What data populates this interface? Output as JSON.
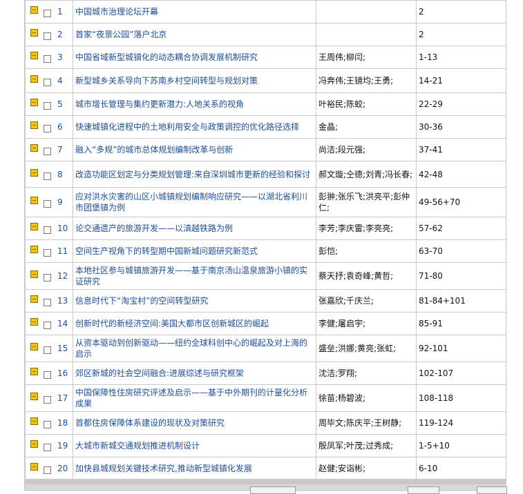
{
  "rows": [
    {
      "num": "1",
      "title": "中国城市治理论坛开幕",
      "authors": "",
      "pages": "2"
    },
    {
      "num": "2",
      "title": "首家“夜景公园”落户北京",
      "authors": "",
      "pages": "2"
    },
    {
      "num": "3",
      "title": "中国省域新型城镇化的动态耦合协调发展机制研究",
      "authors": "王周伟;柳闫;",
      "pages": "1-13"
    },
    {
      "num": "4",
      "title": "新型城乡关系导向下苏南乡村空间转型与规划对策",
      "authors": "冯奔伟;王镜均;王勇;",
      "pages": "14-21"
    },
    {
      "num": "5",
      "title": "城市增长管理与集约更新潜力:人地关系的视角",
      "authors": "叶裕民;陈蛟;",
      "pages": "22-29"
    },
    {
      "num": "6",
      "title": "快速城镇化进程中的土地利用安全与政策调控的优化路径选择",
      "authors": "金晶;",
      "pages": "30-36"
    },
    {
      "num": "7",
      "title": "融入“多规”的城市总体规划编制改革与创新",
      "authors": "尚洁;段元强;",
      "pages": "37-41"
    },
    {
      "num": "8",
      "title": "改造功能区划定与分类规划管理:来自深圳城市更新的经验和探讨",
      "authors": "郝文璇;仝德;刘青;冯长春;",
      "pages": "42-48"
    },
    {
      "num": "9",
      "title": "应对洪水灾害的山区小城镇规划编制响应研究——以湖北省利川市团堡镇为例",
      "authors": "彭翀;张乐飞;洪亮平;彭仲仁;",
      "pages": "49-56+70"
    },
    {
      "num": "10",
      "title": "论交通遗产的旅游开发——以滇越铁路为例",
      "authors": "李芳;李庆雷;李亮亮;",
      "pages": "57-62"
    },
    {
      "num": "11",
      "title": "空间生产视角下的转型期中国新城问题研究新范式",
      "authors": "彭恺;",
      "pages": "63-70"
    },
    {
      "num": "12",
      "title": "本地社区参与城镇旅游开发——基于南京汤山温泉旅游小镇的实证研究",
      "authors": "蔡天抒;袁奇峰;黄哲;",
      "pages": "71-80"
    },
    {
      "num": "13",
      "title": "信息时代下“淘宝村”的空间转型研究",
      "authors": "张嘉欣;千庆兰;",
      "pages": "81-84+101"
    },
    {
      "num": "14",
      "title": "创新时代的新经济空间:美国大都市区创新城区的崛起",
      "authors": "李健;屠启宇;",
      "pages": "85-91"
    },
    {
      "num": "15",
      "title": "从资本驱动到创新驱动——纽约全球科创中心的崛起及对上海的启示",
      "authors": "盛垒;洪娜;黄亮;张虹;",
      "pages": "92-101"
    },
    {
      "num": "16",
      "title": "郊区新城的社会空间融合:进展综述与研究框架",
      "authors": "沈洁;罗翔;",
      "pages": "102-107"
    },
    {
      "num": "17",
      "title": "中国保障性住房研究评述及启示——基于中外期刊的计量化分析成果",
      "authors": "徐苗;杨碧波;",
      "pages": "108-118"
    },
    {
      "num": "18",
      "title": "首都住房保障体系建设的现状及对策研究",
      "authors": "周毕文;陈庆平;王树静;",
      "pages": "119-124"
    },
    {
      "num": "19",
      "title": "大城市新城交通规划推进机制设计",
      "authors": "殷凤军;叶茂;过秀成;",
      "pages": "1-5+10"
    },
    {
      "num": "20",
      "title": "加快县城规划关键技术研究,推动新型城镇化发展",
      "authors": "赵健;安诣彬;",
      "pages": "6-10"
    }
  ],
  "icons": {
    "highlight": "highlighter-icon"
  }
}
